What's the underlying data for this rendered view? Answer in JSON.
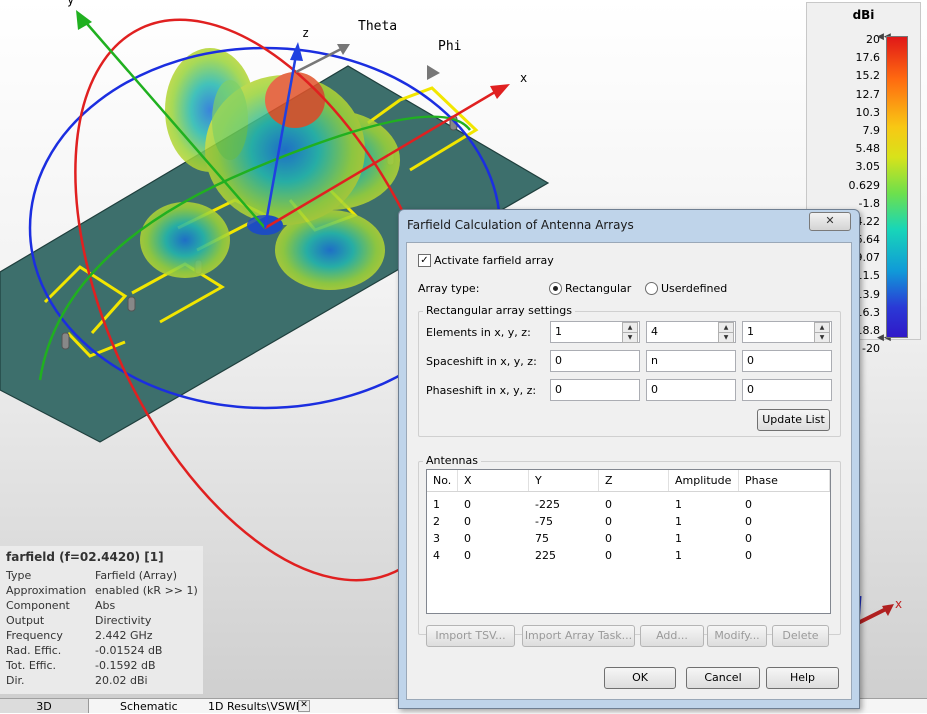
{
  "viewport": {
    "axis_labels": {
      "x": "x",
      "y": "y",
      "z": "z",
      "theta": "Theta",
      "phi": "Phi"
    }
  },
  "legend": {
    "unit": "dBi",
    "ticks": [
      "20",
      "17.6",
      "15.2",
      "12.7",
      "10.3",
      "7.9",
      "5.48",
      "3.05",
      "0.629",
      "-1.8",
      "-4.22",
      "-6.64",
      "-9.07",
      "-11.5",
      "-13.9",
      "-16.3",
      "-18.8",
      "-20"
    ]
  },
  "info_panel": {
    "title": "farfield (f=02.4420) [1]",
    "rows": [
      {
        "key": "Type",
        "value": "Farfield (Array)"
      },
      {
        "key": "Approximation",
        "value": "enabled (kR >> 1)"
      },
      {
        "key": "Component",
        "value": "Abs"
      },
      {
        "key": "Output",
        "value": "Directivity"
      },
      {
        "key": "Frequency",
        "value": "2.442 GHz"
      },
      {
        "key": "Rad. Effic.",
        "value": "-0.01524 dB"
      },
      {
        "key": "Tot. Effic.",
        "value": "-0.1592 dB"
      },
      {
        "key": "Dir.",
        "value": "20.02 dBi"
      }
    ]
  },
  "tabs": [
    "3D",
    "Schematic",
    "1D Results\\VSWR"
  ],
  "dialog": {
    "title": "Farfield Calculation of Antenna Arrays",
    "close_label": "✕",
    "activate_label": "Activate farfield array",
    "activate_checked": true,
    "array_type_label": "Array type:",
    "rectangular_label": "Rectangular",
    "userdefined_label": "Userdefined",
    "rect_group_label": "Rectangular array settings",
    "elements_label": "Elements in x, y, z:",
    "elements": [
      "1",
      "4",
      "1"
    ],
    "spaceshift_label": "Spaceshift in x, y, z:",
    "spaceshift": [
      "0",
      "n",
      "0"
    ],
    "phaseshift_label": "Phaseshift in x, y, z:",
    "phaseshift": [
      "0",
      "0",
      "0"
    ],
    "update_list": "Update List",
    "antennas_group_label": "Antennas",
    "columns": [
      "No.",
      "X",
      "Y",
      "Z",
      "Amplitude",
      "Phase"
    ],
    "rows": [
      [
        "1",
        "0",
        "-225",
        "0",
        "1",
        "0"
      ],
      [
        "2",
        "0",
        "-75",
        "0",
        "1",
        "0"
      ],
      [
        "3",
        "0",
        "75",
        "0",
        "1",
        "0"
      ],
      [
        "4",
        "0",
        "225",
        "0",
        "1",
        "0"
      ]
    ],
    "list_buttons": [
      "Import TSV...",
      "Import Array Task...",
      "Add...",
      "Modify...",
      "Delete"
    ],
    "ok": "OK",
    "cancel": "Cancel",
    "help": "Help"
  },
  "colors": {
    "substrate": "#3d6f6c",
    "trace": "#f2e600",
    "x_axis": "#e02020",
    "y_axis": "#20b020",
    "z_axis": "#2040e0"
  }
}
